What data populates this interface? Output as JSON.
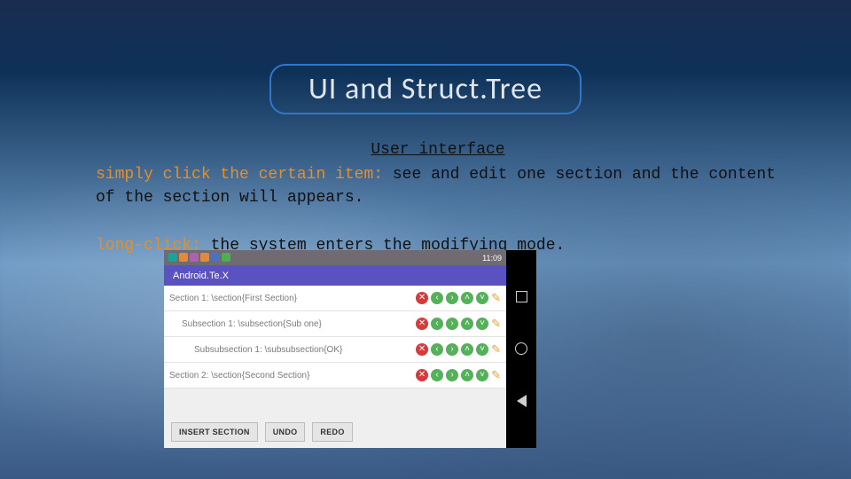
{
  "title": "UI and Struct.Tree",
  "subhead": "User interface",
  "text": {
    "simply_lead": "simply click the certain item:",
    "simply_rest": " see and edit one section and the content of the section will appears.",
    "long_lead": "long-click:",
    "long_rest": "  the system enters the modifying mode."
  },
  "phone": {
    "status_time": "11:09",
    "app_title": "Android.Te.X",
    "rows": [
      {
        "label": "Section 1: \\section{First Section}"
      },
      {
        "label": "Subsection 1: \\subsection{Sub one}"
      },
      {
        "label": "Subsubsection 1: \\subsubsection{OK}"
      },
      {
        "label": "Section 2: \\section{Second Section}"
      }
    ],
    "buttons": {
      "insert": "INSERT SECTION",
      "undo": "UNDO",
      "redo": "REDO"
    }
  }
}
